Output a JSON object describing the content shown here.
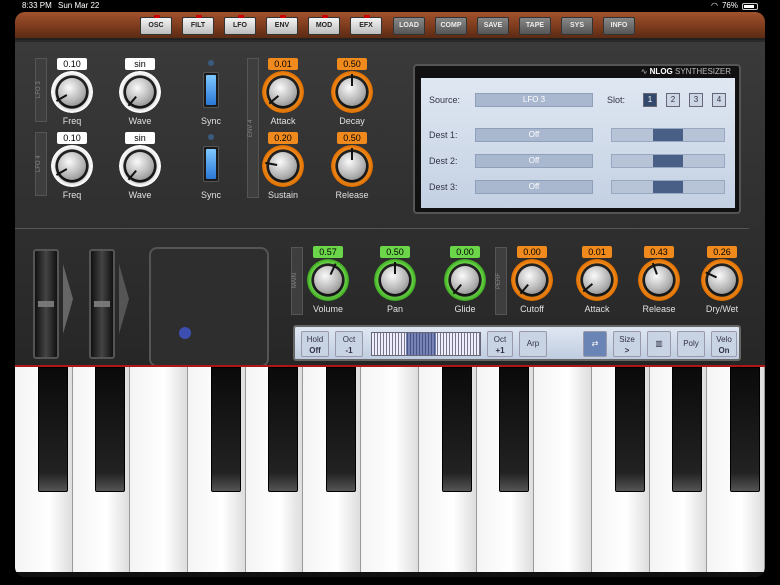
{
  "status": {
    "time": "8:33 PM",
    "date": "Sun Mar 22",
    "battery": "76%"
  },
  "toolbar": [
    {
      "label": "OSC",
      "led": true
    },
    {
      "label": "FILT",
      "led": true
    },
    {
      "label": "LFO",
      "led": true
    },
    {
      "label": "ENV",
      "led": true
    },
    {
      "label": "MOD",
      "led": true
    },
    {
      "label": "EFX",
      "led": true
    },
    {
      "label": "LOAD",
      "led": false
    },
    {
      "label": "COMP",
      "led": false
    },
    {
      "label": "SAVE",
      "led": false
    },
    {
      "label": "TAPE",
      "led": false
    },
    {
      "label": "SYS",
      "led": false
    },
    {
      "label": "INFO",
      "led": false
    }
  ],
  "lfo3": {
    "label": "LFO 3",
    "freq": "0.10",
    "wave": "sin",
    "freq_label": "Freq",
    "wave_label": "Wave",
    "sync_label": "Sync"
  },
  "lfo4": {
    "label": "LFO 4",
    "freq": "0.10",
    "wave": "sin",
    "freq_label": "Freq",
    "wave_label": "Wave",
    "sync_label": "Sync"
  },
  "env4": {
    "label": "ENV 4",
    "attack": "0.01",
    "decay": "0.50",
    "sustain": "0.20",
    "release": "0.50",
    "attack_label": "Attack",
    "decay_label": "Decay",
    "sustain_label": "Sustain",
    "release_label": "Release"
  },
  "screen": {
    "logo_brand": "NLOG",
    "logo_rest": " SYNTHESIZER",
    "source_label": "Source:",
    "source_value": "LFO 3",
    "slot_label": "Slot:",
    "slots": [
      "1",
      "2",
      "3",
      "4"
    ],
    "active_slot": 0,
    "dests": [
      {
        "label": "Dest  1:",
        "value": "Off",
        "amount": 0.5
      },
      {
        "label": "Dest  2:",
        "value": "Off",
        "amount": 0.5
      },
      {
        "label": "Dest  3:",
        "value": "Off",
        "amount": 0.5
      }
    ]
  },
  "main": {
    "label": "MAIN",
    "volume": "0.57",
    "pan": "0.50",
    "glide": "0.00",
    "volume_label": "Volume",
    "pan_label": "Pan",
    "glide_label": "Glide"
  },
  "perf": {
    "label": "PERF",
    "cutoff": "0.00",
    "attack": "0.01",
    "release": "0.43",
    "drywet": "0.26",
    "cutoff_label": "Cutoff",
    "attack_label": "Attack",
    "release_label": "Release",
    "drywet_label": "Dry/Wet"
  },
  "kbctl": {
    "hold_label": "Hold",
    "hold_value": "Off",
    "octm_label": "Oct",
    "octm_value": "-1",
    "octp_label": "Oct",
    "octp_value": "+1",
    "arp": "Arp",
    "size_label": "Size",
    "size_value": ">",
    "poly": "Poly",
    "velo_label": "Velo",
    "velo_value": "On"
  }
}
